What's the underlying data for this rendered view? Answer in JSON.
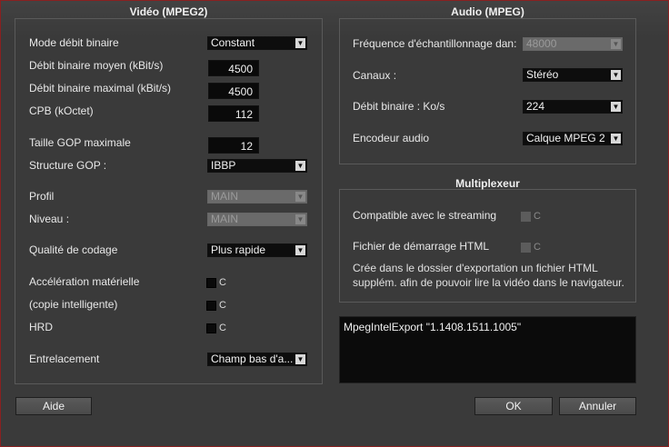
{
  "video": {
    "title": "Vidéo (MPEG2)",
    "mode_label": "Mode débit binaire",
    "mode_value": "Constant",
    "avg_label": "Débit binaire moyen (kBit/s)",
    "avg_value": "4500",
    "max_label": "Débit binaire maximal (kBit/s)",
    "max_value": "4500",
    "cpb_label": "CPB (kOctet)",
    "cpb_value": "112",
    "gop_label": "Taille GOP maximale",
    "gop_value": "12",
    "gopstruct_label": "Structure GOP :",
    "gopstruct_value": "IBBP",
    "profile_label": "Profil",
    "profile_value": "MAIN",
    "level_label": "Niveau :",
    "level_value": "MAIN",
    "quality_label": "Qualité de codage",
    "quality_value": "Plus rapide",
    "hwaccel_label": "Accélération matérielle",
    "smartcopy_label": "(copie intelligente)",
    "hrd_label": "HRD",
    "check_caption": "C",
    "interlace_label": "Entrelacement",
    "interlace_value": "Champ bas d'a..."
  },
  "audio": {
    "title": "Audio (MPEG)",
    "freq_label": "Fréquence d'échantillonnage dan:",
    "freq_value": "48000",
    "channels_label": "Canaux :",
    "channels_value": "Stéréo",
    "bitrate_label": "Débit binaire :  Ko/s",
    "bitrate_value": "224",
    "encoder_label": "Encodeur audio",
    "encoder_value": "Calque MPEG 2"
  },
  "mux": {
    "title": "Multiplexeur",
    "streaming_label": "Compatible avec le streaming",
    "html_label": "Fichier de démarrage HTML",
    "check_caption": "C",
    "info_line1": "Crée dans le dossier d'exportation un fichier HTML",
    "info_line2": "supplém. afin de pouvoir lire la vidéo dans le navigateur."
  },
  "log_text": "MpegIntelExport \"1.1408.1511.1005\"",
  "buttons": {
    "help": "Aide",
    "ok": "OK",
    "cancel": "Annuler"
  },
  "icons": {
    "dropdown_arrow": "▼"
  }
}
